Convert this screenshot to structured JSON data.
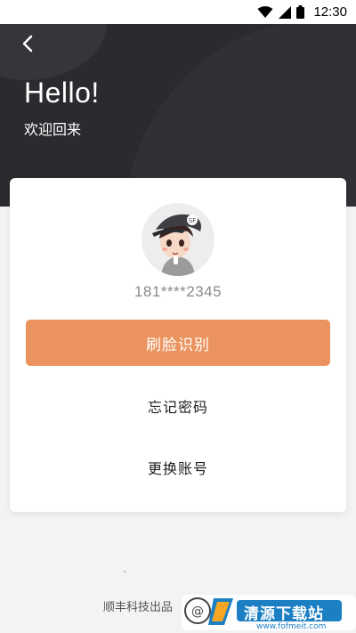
{
  "status_bar": {
    "time": "12:30",
    "icons": [
      "wifi-icon",
      "signal-icon",
      "battery-icon"
    ]
  },
  "header": {
    "greeting": "Hello!",
    "subtitle": "欢迎回来"
  },
  "card": {
    "phone_masked": "181****2345",
    "face_login_label": "刷脸识别",
    "forgot_password_label": "忘记密码",
    "switch_account_label": "更换账号"
  },
  "footer": {
    "text": "顺丰科技出品"
  },
  "watermark": {
    "text": "清源下载站",
    "url": "www.fofmeit.com"
  },
  "colors": {
    "header_bg": "#2b2b2f",
    "accent": "#eb935f",
    "page_bg": "#f3f3f5"
  }
}
